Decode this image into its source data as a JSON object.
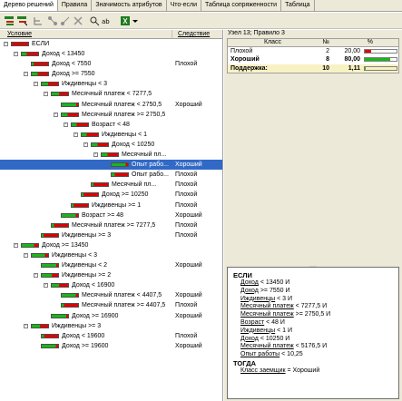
{
  "tabs": [
    "Дерево решений",
    "Правила",
    "Значимость атрибутов",
    "Что-если",
    "Таблица сопряженности",
    "Таблица"
  ],
  "tree": {
    "col_condition": "Условие",
    "col_result": "Следствие",
    "rows": [
      {
        "l": 0,
        "e": "-",
        "t": "ЕСЛИ",
        "r": "",
        "g": 0
      },
      {
        "l": 1,
        "e": "-",
        "t": "Доход < 13450",
        "r": "",
        "g": 0.3
      },
      {
        "l": 2,
        "e": "",
        "t": "Доход < 7550",
        "r": "Плохой",
        "g": 0.1
      },
      {
        "l": 2,
        "e": "-",
        "t": "Доход >= 7550",
        "r": "",
        "g": 0.35
      },
      {
        "l": 3,
        "e": "-",
        "t": "Иждивенцы < 3",
        "r": "",
        "g": 0.4
      },
      {
        "l": 4,
        "e": "-",
        "t": "Месячный платеж < 7277,5",
        "r": "",
        "g": 0.45
      },
      {
        "l": 5,
        "e": "",
        "t": "Месячный платеж < 2750,5",
        "r": "Хороший",
        "g": 0.9
      },
      {
        "l": 5,
        "e": "-",
        "t": "Месячный платеж >= 2750,5",
        "r": "",
        "g": 0.35
      },
      {
        "l": 6,
        "e": "-",
        "t": "Возраст < 48",
        "r": "",
        "g": 0.3
      },
      {
        "l": 7,
        "e": "-",
        "t": "Иждивенцы < 1",
        "r": "",
        "g": 0.3
      },
      {
        "l": 8,
        "e": "-",
        "t": "Доход < 10250",
        "r": "",
        "g": 0.35
      },
      {
        "l": 9,
        "e": "-",
        "t": "Месячный пл...",
        "r": "",
        "g": 0.35
      },
      {
        "l": 10,
        "e": "",
        "t": "Опыт рабо...",
        "r": "Хороший",
        "g": 0.85,
        "sel": true
      },
      {
        "l": 10,
        "e": "",
        "t": "Опыт рабо...",
        "r": "Плохой",
        "g": 0.2
      },
      {
        "l": 8,
        "e": "",
        "t": "Месячный пл...",
        "r": "Плохой",
        "g": 0.1
      },
      {
        "l": 7,
        "e": "",
        "t": "Доход >= 10250",
        "r": "Плохой",
        "g": 0.1
      },
      {
        "l": 6,
        "e": "",
        "t": "Иждивенцы >= 1",
        "r": "Плохой",
        "g": 0.1
      },
      {
        "l": 5,
        "e": "",
        "t": "Возраст >= 48",
        "r": "Хороший",
        "g": 0.85
      },
      {
        "l": 4,
        "e": "",
        "t": "Месячный платеж >= 7277,5",
        "r": "Плохой",
        "g": 0.15
      },
      {
        "l": 3,
        "e": "",
        "t": "Иждивенцы >= 3",
        "r": "Плохой",
        "g": 0.1
      },
      {
        "l": 1,
        "e": "-",
        "t": "Доход >= 13450",
        "r": "",
        "g": 0.75
      },
      {
        "l": 2,
        "e": "-",
        "t": "Иждивенцы < 3",
        "r": "",
        "g": 0.8
      },
      {
        "l": 3,
        "e": "",
        "t": "Иждивенцы < 2",
        "r": "Хороший",
        "g": 0.9
      },
      {
        "l": 3,
        "e": "-",
        "t": "Иждивенцы >= 2",
        "r": "",
        "g": 0.6
      },
      {
        "l": 4,
        "e": "-",
        "t": "Доход < 16900",
        "r": "",
        "g": 0.45
      },
      {
        "l": 5,
        "e": "",
        "t": "Месячный платеж < 4407,5",
        "r": "Хороший",
        "g": 0.85
      },
      {
        "l": 5,
        "e": "",
        "t": "Месячный платеж >= 4407,5",
        "r": "Плохой",
        "g": 0.15
      },
      {
        "l": 4,
        "e": "",
        "t": "Доход >= 16900",
        "r": "Хороший",
        "g": 0.9
      },
      {
        "l": 2,
        "e": "-",
        "t": "Иждивенцы >= 3",
        "r": "",
        "g": 0.5
      },
      {
        "l": 3,
        "e": "",
        "t": "Доход < 19600",
        "r": "Плохой",
        "g": 0.15
      },
      {
        "l": 3,
        "e": "",
        "t": "Доход >= 19600",
        "r": "Хороший",
        "g": 0.85
      }
    ]
  },
  "node": {
    "title": "Узел 13; Правило 3",
    "headers": [
      "Класс",
      "№",
      "%"
    ],
    "rows": [
      {
        "cls": "Плохой",
        "n": "2",
        "p": "20,00",
        "frac": 0.2,
        "color": "#e00000",
        "bold": false
      },
      {
        "cls": "Хороший",
        "n": "8",
        "p": "80,00",
        "frac": 0.8,
        "color": "#18b818",
        "bold": true
      },
      {
        "cls": "Поддержка:",
        "n": "10",
        "p": "1,11",
        "frac": 0.0111,
        "color": "#18b818",
        "bold": true,
        "sup": true
      }
    ]
  },
  "rule": {
    "if": "ЕСЛИ",
    "conds": [
      {
        "a": "Доход",
        "v": " < 13450 И"
      },
      {
        "a": "Доход",
        "v": " >= 7550 И"
      },
      {
        "a": "Иждивенцы",
        "v": " < 3 И"
      },
      {
        "a": "Месячный платеж",
        "v": " < 7277,5 И"
      },
      {
        "a": "Месячный платеж",
        "v": " >= 2750,5 И"
      },
      {
        "a": "Возраст",
        "v": " < 48 И"
      },
      {
        "a": "Иждивенцы",
        "v": " < 1 И"
      },
      {
        "a": "Доход",
        "v": " < 10250 И"
      },
      {
        "a": "Месячный платеж",
        "v": " < 5176,5 И"
      },
      {
        "a": "Опыт работы",
        "v": " < 10,25"
      }
    ],
    "then": "ТОГДА",
    "concl": {
      "a": "Класс заемщик",
      "v": " = Хороший"
    }
  },
  "colors": {
    "good": "#18b818",
    "bad": "#e00000",
    "selection": "#3169c6",
    "support": "#f8f1c4"
  }
}
